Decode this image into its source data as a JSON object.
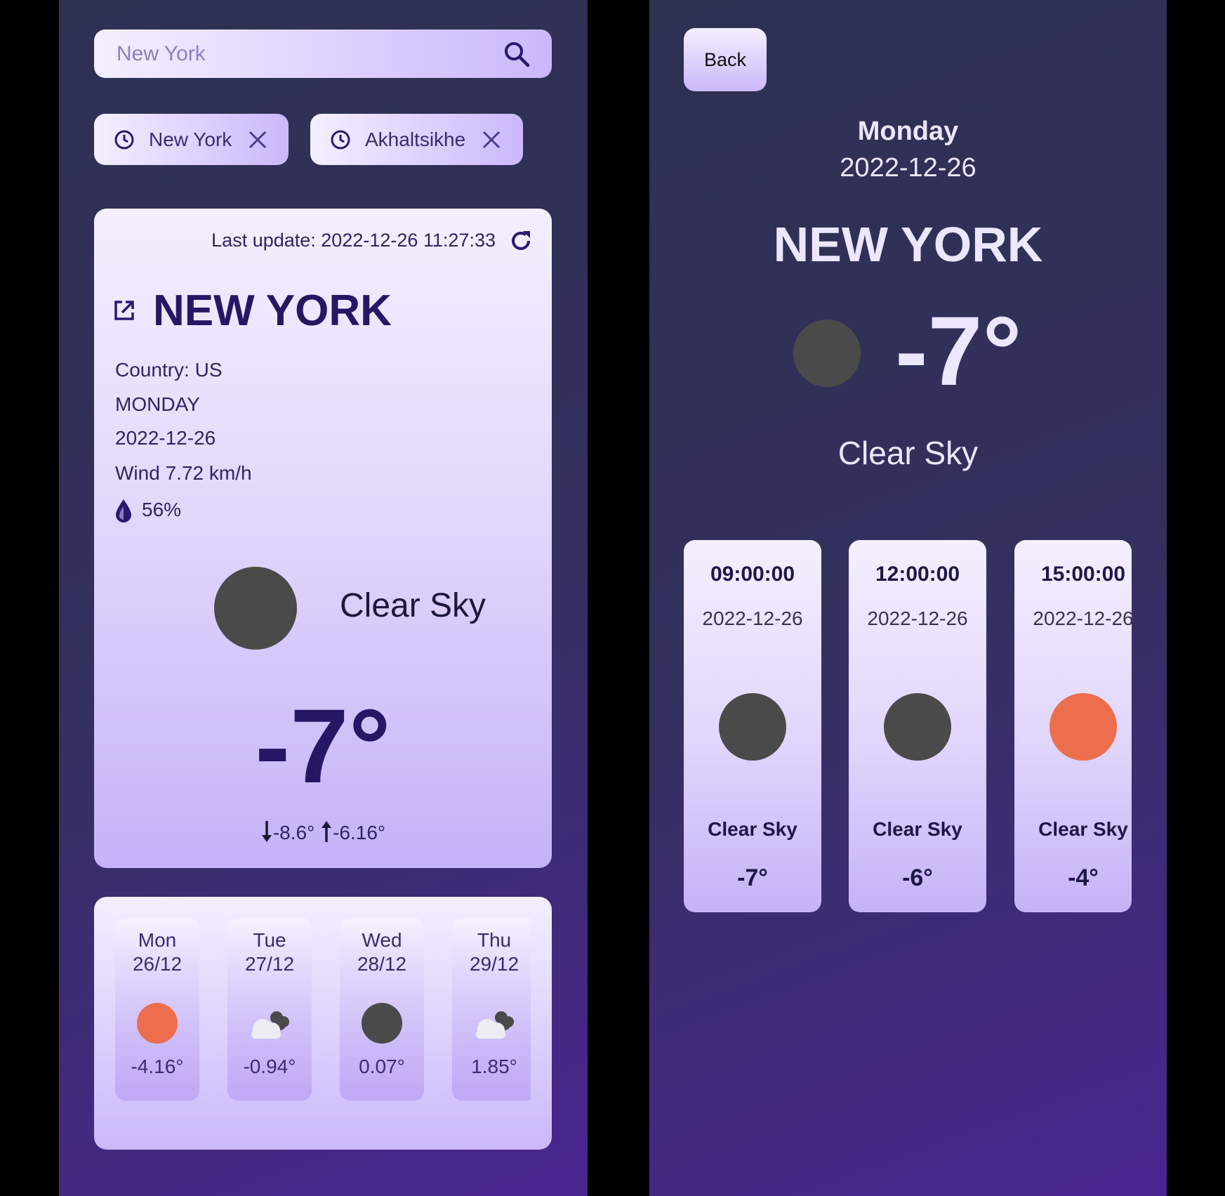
{
  "left": {
    "search": {
      "placeholder": "New York"
    },
    "recent": [
      {
        "label": "New York"
      },
      {
        "label": "Akhaltsikhe"
      }
    ],
    "current": {
      "last_update": "Last update: 2022-12-26 11:27:33",
      "city": "NEW YORK",
      "country": "Country: US",
      "weekday": "MONDAY",
      "date": "2022-12-26",
      "wind": "Wind 7.72 km/h",
      "humidity": "56%",
      "condition": "Clear Sky",
      "temp": "-7°",
      "min": "-8.6°",
      "max": "-6.16°"
    },
    "forecast": [
      {
        "day": "Mon",
        "date": "26/12",
        "icon": "sun-icon",
        "temp": "-4.16°"
      },
      {
        "day": "Tue",
        "date": "27/12",
        "icon": "cloud-icon",
        "temp": "-0.94°"
      },
      {
        "day": "Wed",
        "date": "28/12",
        "icon": "night-icon",
        "temp": "0.07°"
      },
      {
        "day": "Thu",
        "date": "29/12",
        "icon": "cloud-icon",
        "temp": "1.85°"
      }
    ]
  },
  "right": {
    "back_label": "Back",
    "weekday": "Monday",
    "date": "2022-12-26",
    "city": "NEW YORK",
    "temp": "-7°",
    "condition": "Clear Sky",
    "hourly": [
      {
        "time": "09:00:00",
        "date": "2022-12-26",
        "icon": "night-icon",
        "condition": "Clear Sky",
        "temp": "-7°"
      },
      {
        "time": "12:00:00",
        "date": "2022-12-26",
        "icon": "night-icon",
        "condition": "Clear Sky",
        "temp": "-6°"
      },
      {
        "time": "15:00:00",
        "date": "2022-12-26",
        "icon": "sun-icon",
        "condition": "Clear Sky",
        "temp": "-4°"
      }
    ]
  },
  "colors": {
    "night": "#4a4a4a",
    "sun": "#ec6e4d",
    "accent_text": "#271664"
  }
}
